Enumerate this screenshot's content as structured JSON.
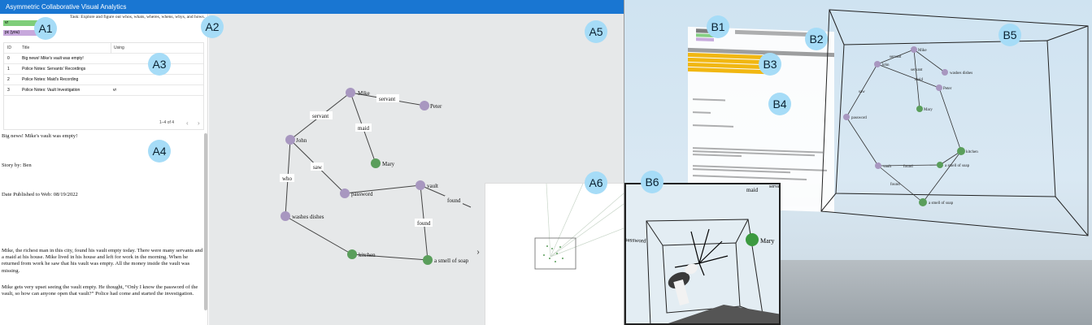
{
  "app": {
    "title": "Asymmetric Collaborative Visual Analytics"
  },
  "users": [
    {
      "label": "vr",
      "color": "#7fce7a"
    },
    {
      "label": "pc (you)",
      "color": "#c7a8dc"
    }
  ],
  "task": {
    "text": "Task: Explore and figure out whos, whats, wheres, whens, whys, and hows."
  },
  "table": {
    "columns": [
      "ID",
      "Title",
      "Using"
    ],
    "rows": [
      {
        "id": "0",
        "title": "Big news! Mike's vault was empty!",
        "using": ""
      },
      {
        "id": "1",
        "title": "Police Notes: Servants' Recordings",
        "using": ""
      },
      {
        "id": "2",
        "title": "Police Notes: Maid's Recording",
        "using": ""
      },
      {
        "id": "3",
        "title": "Police Notes: Vault Investigation",
        "using": "vr"
      }
    ],
    "pagination": "1–4 of 4",
    "prev": "‹",
    "next": "›"
  },
  "document": {
    "headline": "Big news! Mike's vault was empty!",
    "byline": "Story by: Ben",
    "date": "Date Published to Web: 08/19/2022",
    "paragraph1": "Mike, the richest man in this city, found his vault empty today. There were many servants and a maid at his house. Mike lived in his house and left for work in the morning. When he returned from work he saw that his vault was empty. All the money inside the vault was missing.",
    "paragraph2": "Mike gets very upset seeing the vault empty. He thought, “Only I know the password of the vault, so how can anyone open that vault?” Police had come and started the investigation."
  },
  "graph": {
    "nodes": {
      "mike": "Mike",
      "peter": "Peter",
      "john": "John",
      "mary": "Mary",
      "password": "password",
      "vault": "vault",
      "washes": "washes dishes",
      "kitchen": "kitchen",
      "soap": "a smell of soap"
    },
    "edges": {
      "servant1": "servant",
      "servant2": "servant",
      "maid": "maid",
      "saw": "saw",
      "who": "who",
      "found1": "found",
      "found2": "found"
    },
    "colors": {
      "entity": "#a897c0",
      "shared": "#5a9e5b"
    }
  },
  "minimap": {
    "toggle": "›"
  },
  "vr": {
    "cube_labels": {
      "mike": "Mike",
      "servant": "servant",
      "maid": "maid",
      "peter": "Peter",
      "washes": "washes dishes",
      "saw": "saw",
      "mary": "Mary",
      "password": "password",
      "kitchen": "kitchen",
      "vault": "vault",
      "found1": "found",
      "found2": "found",
      "soap": "a smell of soap",
      "john": "John"
    },
    "inset_labels": {
      "maid": "maid",
      "servant": "serva",
      "password": "password",
      "mary": "Mary"
    }
  },
  "badges": [
    "A1",
    "A2",
    "A3",
    "A4",
    "A5",
    "A6",
    "B1",
    "B2",
    "B3",
    "B4",
    "B5",
    "B6"
  ]
}
